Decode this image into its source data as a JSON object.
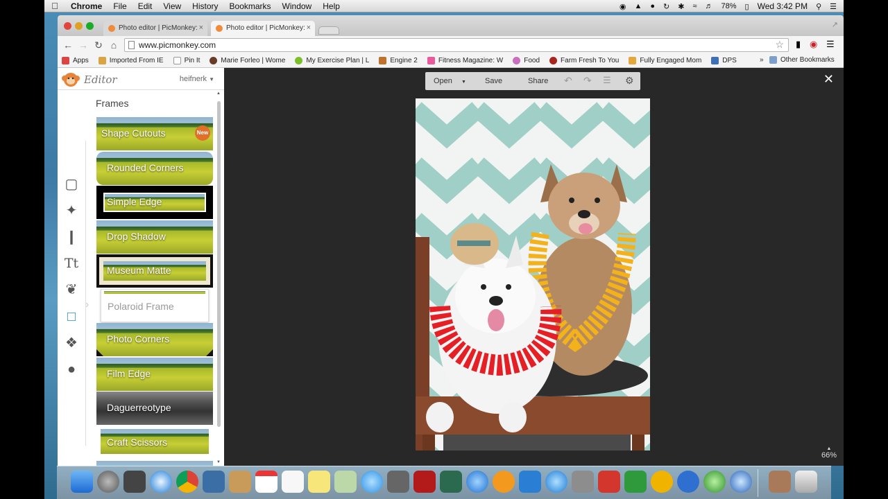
{
  "menubar": {
    "app": "Chrome",
    "items": [
      "File",
      "Edit",
      "View",
      "History",
      "Bookmarks",
      "Window",
      "Help"
    ],
    "battery": "78%",
    "clock": "Wed 3:42 PM"
  },
  "browser": {
    "tabs": [
      {
        "label": "Photo editor | PicMonkey:"
      },
      {
        "label": "Photo editor | PicMonkey:"
      }
    ],
    "url": "www.picmonkey.com",
    "bookmarks": [
      {
        "label": "Apps",
        "color": "#d44"
      },
      {
        "label": "Imported From IE",
        "color": "#d9a441"
      },
      {
        "label": "Pin It",
        "color": "#fff"
      },
      {
        "label": "Marie Forleo | Wome",
        "color": "#6b3b2a"
      },
      {
        "label": "My Exercise Plan | L",
        "color": "#7bbf2a"
      },
      {
        "label": "Engine 2",
        "color": "#c0722d"
      },
      {
        "label": "Fitness Magazine: W",
        "color": "#e85a9c"
      },
      {
        "label": "Food",
        "color": "#c86fbe"
      },
      {
        "label": "Farm Fresh To You",
        "color": "#a7251c"
      },
      {
        "label": "Fully Engaged Mom",
        "color": "#e4a83a"
      },
      {
        "label": "DPS",
        "color": "#3f6fb5"
      }
    ],
    "overflow": "»",
    "other_bookmarks": "Other Bookmarks"
  },
  "editor": {
    "title": "Editor",
    "user": "heifnerk",
    "section_title": "Frames",
    "frames": [
      {
        "label": "Shape Cutouts",
        "badge": "New"
      },
      {
        "label": "Rounded Corners"
      },
      {
        "label": "Simple Edge"
      },
      {
        "label": "Drop Shadow"
      },
      {
        "label": "Museum Matte"
      },
      {
        "label": "Polaroid Frame"
      },
      {
        "label": "Photo Corners"
      },
      {
        "label": "Film Edge"
      },
      {
        "label": "Daguerreotype"
      },
      {
        "label": "Craft Scissors"
      }
    ],
    "toolbar": {
      "open": "Open",
      "save": "Save",
      "share": "Share"
    },
    "zoom": "66%"
  }
}
